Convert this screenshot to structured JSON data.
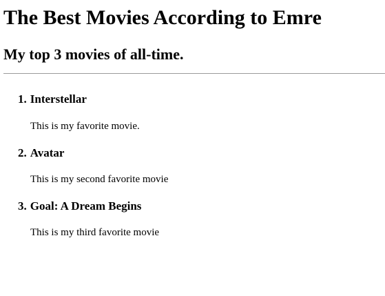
{
  "page": {
    "title": "The Best Movies According to Emre",
    "subtitle": "My top 3 movies of all-time."
  },
  "movies": [
    {
      "number": "1.",
      "title": "Interstellar",
      "description": "This is my favorite movie."
    },
    {
      "number": "2.",
      "title": "Avatar",
      "description": "This is my second favorite movie"
    },
    {
      "number": "3.",
      "title": "Goal: A Dream Begins",
      "description": "This is my third favorite movie"
    }
  ]
}
